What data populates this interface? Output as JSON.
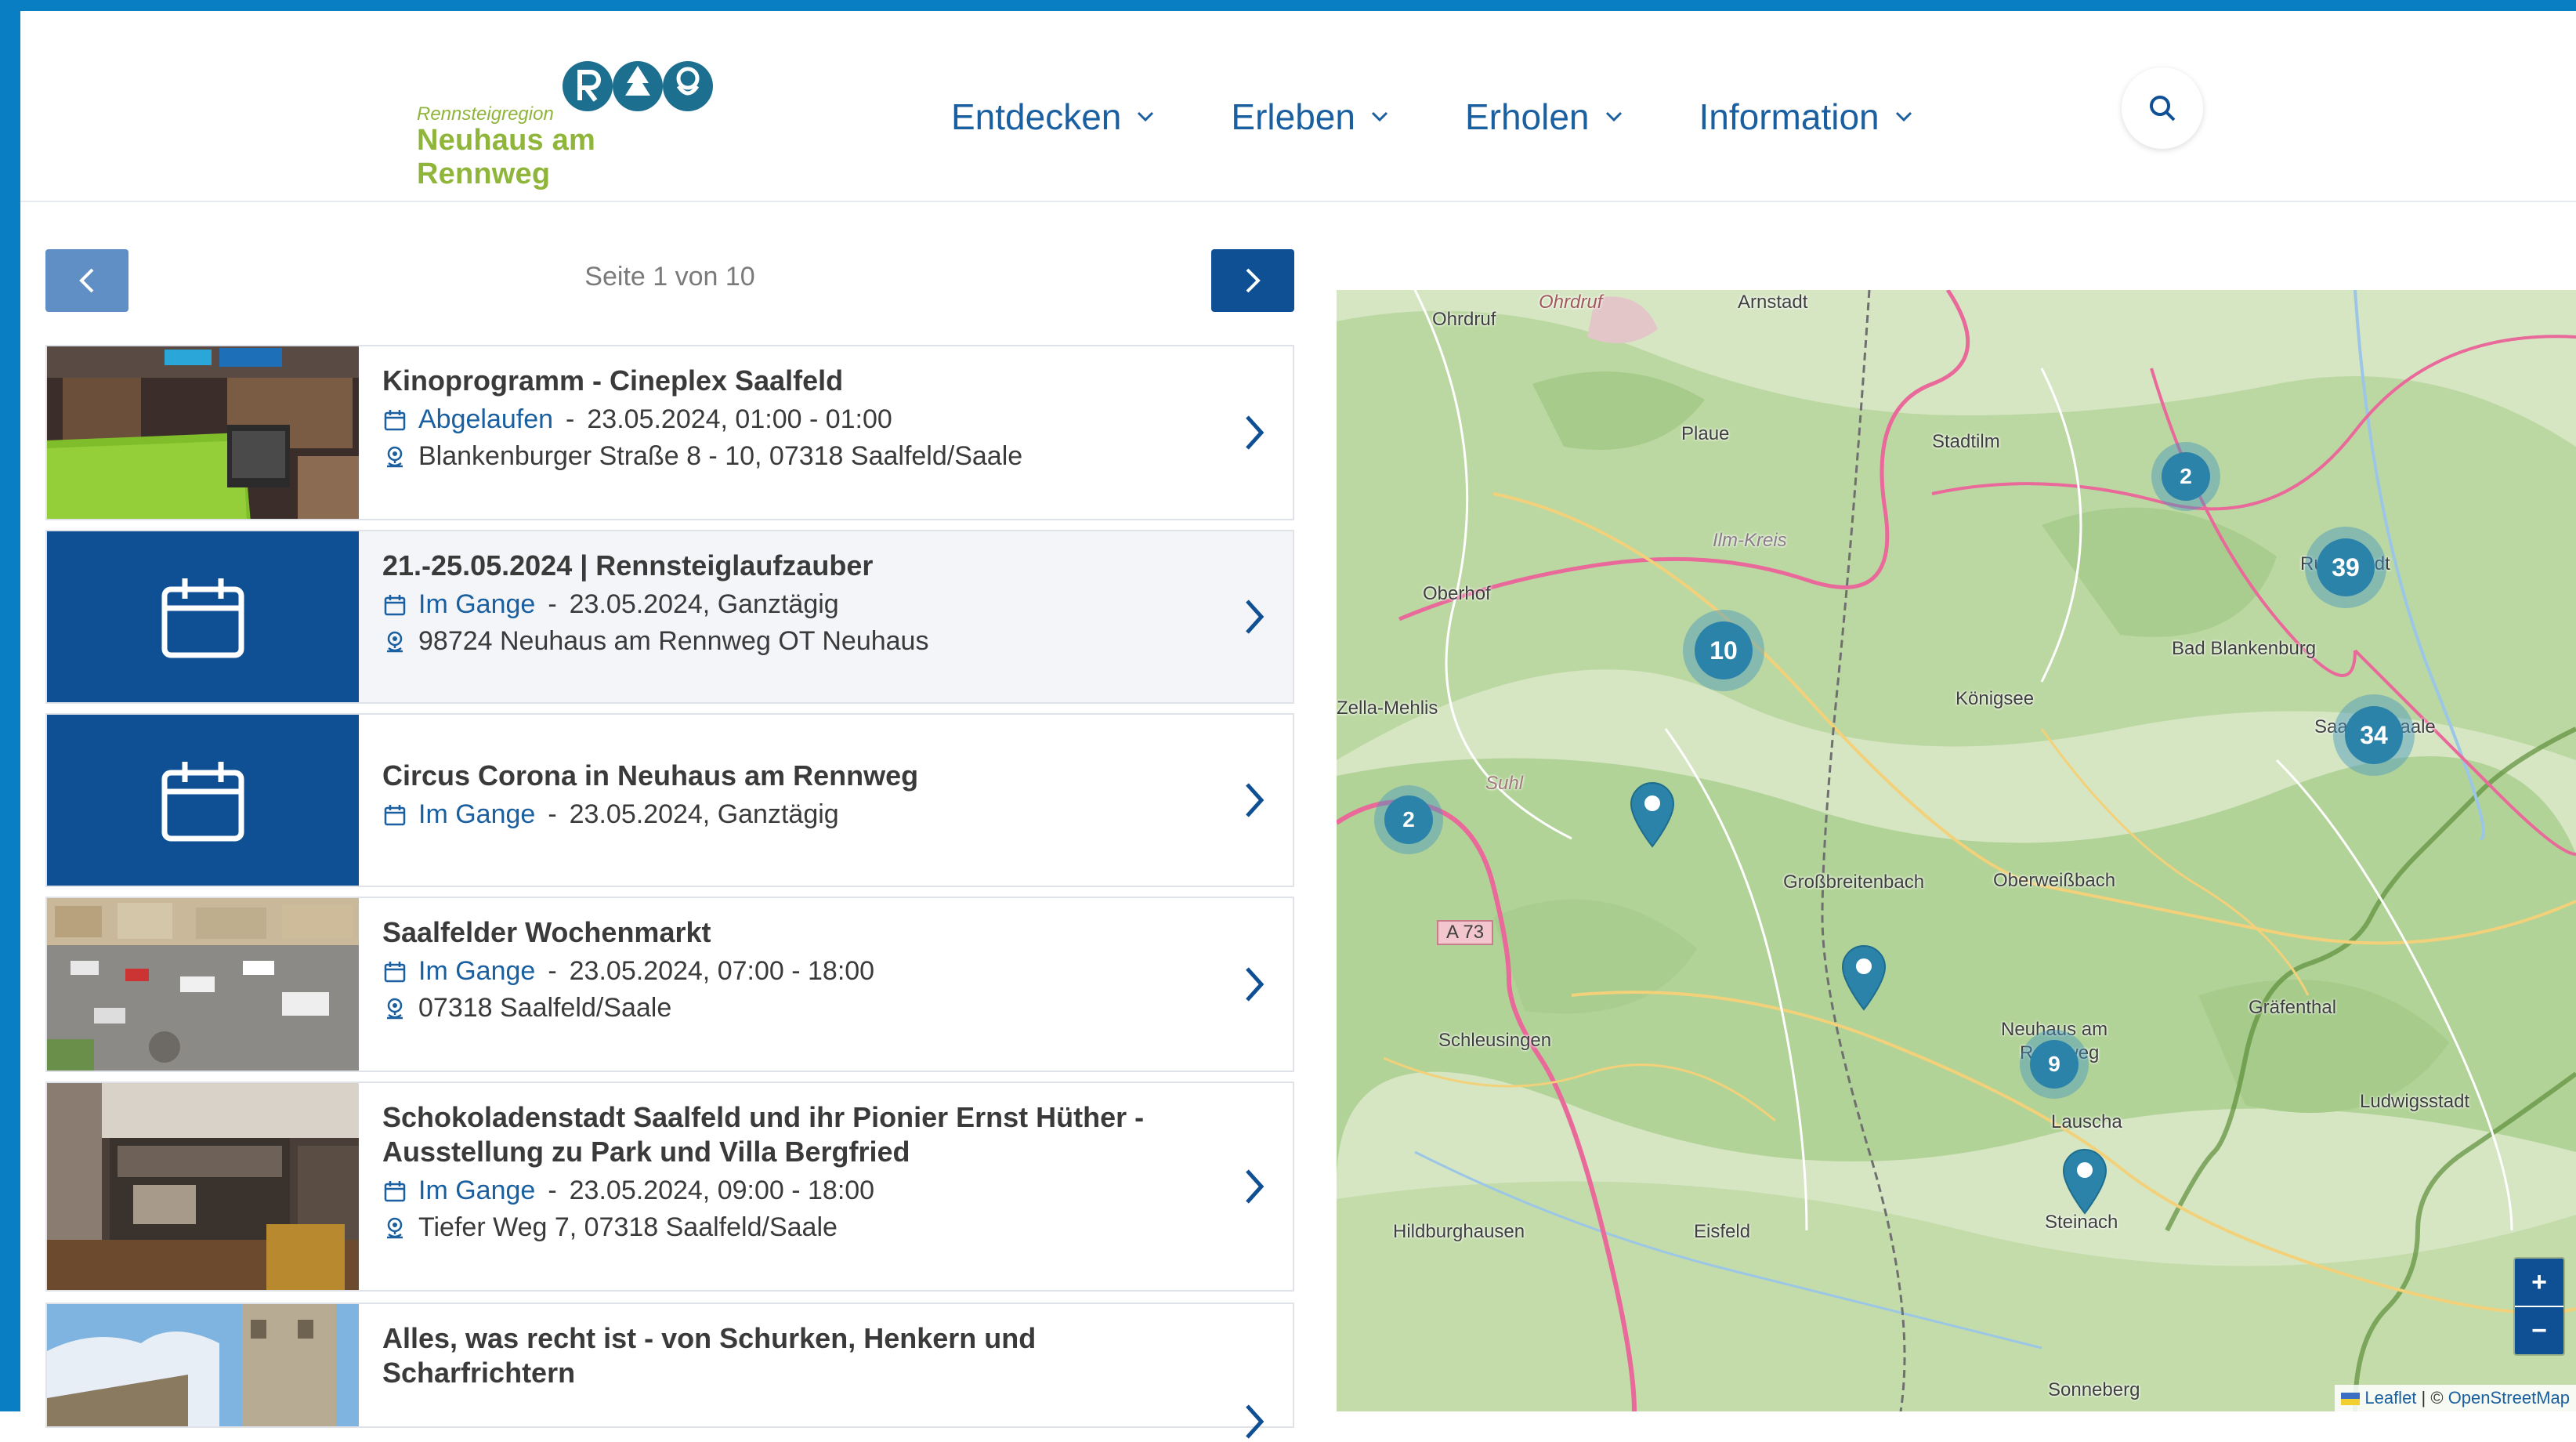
{
  "header": {
    "logo_small": "Rennsteigregion",
    "logo_big": "Neuhaus am Rennweg",
    "nav": [
      {
        "label": "Entdecken"
      },
      {
        "label": "Erleben"
      },
      {
        "label": "Erholen"
      },
      {
        "label": "Information"
      }
    ],
    "search_icon": "search-icon"
  },
  "pager": {
    "text": "Seite 1 von 10",
    "prev_icon": "chevron-left-icon",
    "next_icon": "chevron-right-icon"
  },
  "events": [
    {
      "title": "Kinoprogramm - Cineplex Saalfeld",
      "status": "Abgelaufen",
      "date": "23.05.2024, 01:00 - 01:00",
      "address": "Blankenburger Straße 8 - 10, 07318 Saalfeld/Saale",
      "thumb": "cinema-photo"
    },
    {
      "title": "21.-25.05.2024 | Rennsteiglaufzauber",
      "status": "Im Gange",
      "date": "23.05.2024, Ganztägig",
      "address": "98724 Neuhaus am Rennweg OT Neuhaus",
      "thumb": "calendar-icon"
    },
    {
      "title": "Circus Corona in Neuhaus am Rennweg",
      "status": "Im Gange",
      "date": "23.05.2024, Ganztägig",
      "thumb": "calendar-icon"
    },
    {
      "title": "Saalfelder Wochenmarkt",
      "status": "Im Gange",
      "date": "23.05.2024, 07:00 - 18:00",
      "address": "07318 Saalfeld/Saale",
      "thumb": "market-photo"
    },
    {
      "title": "Schokoladenstadt Saalfeld und ihr Pionier Ernst Hüther - Ausstellung zu Park und Villa Bergfried",
      "status": "Im Gange",
      "date": "23.05.2024, 09:00 - 18:00",
      "address": "Tiefer Weg 7, 07318 Saalfeld/Saale",
      "thumb": "exhibition-photo"
    },
    {
      "title": "Alles, was recht ist - von Schurken, Henkern und Scharfrichtern",
      "thumb": "tower-photo"
    }
  ],
  "map": {
    "places": [
      "Ohrdruf",
      "Ohrdruf",
      "Arnstadt",
      "Plaue",
      "Stadtilm",
      "Ilm-Kreis",
      "Oberhof",
      "Bad Blankenburg",
      "Zella-Mehlis",
      "Königsee",
      "Suhl",
      "Großbreitenbach",
      "Oberweißbach",
      "A 73",
      "Schleusingen",
      "Gräfenthal",
      "Neuhaus am",
      "Rennweg",
      "Lauscha",
      "Ludwigsstadt",
      "Hildburghausen",
      "Eisfeld",
      "Steinach",
      "Sonneberg",
      "Rudolstadt",
      "Saalfeld/Saale"
    ],
    "clusters": [
      {
        "count": "2"
      },
      {
        "count": "39"
      },
      {
        "count": "10"
      },
      {
        "count": "34"
      },
      {
        "count": "2"
      },
      {
        "count": "9"
      }
    ],
    "zoom_in": "+",
    "zoom_out": "−",
    "attribution_leaflet": "Leaflet",
    "attribution_sep": " | © ",
    "attribution_osm": "OpenStreetMap"
  },
  "colors": {
    "brand_blue": "#0f4f94",
    "link_blue": "#1a5fa0",
    "logo_green": "#8fb53a",
    "cluster": "#2b83a9"
  }
}
